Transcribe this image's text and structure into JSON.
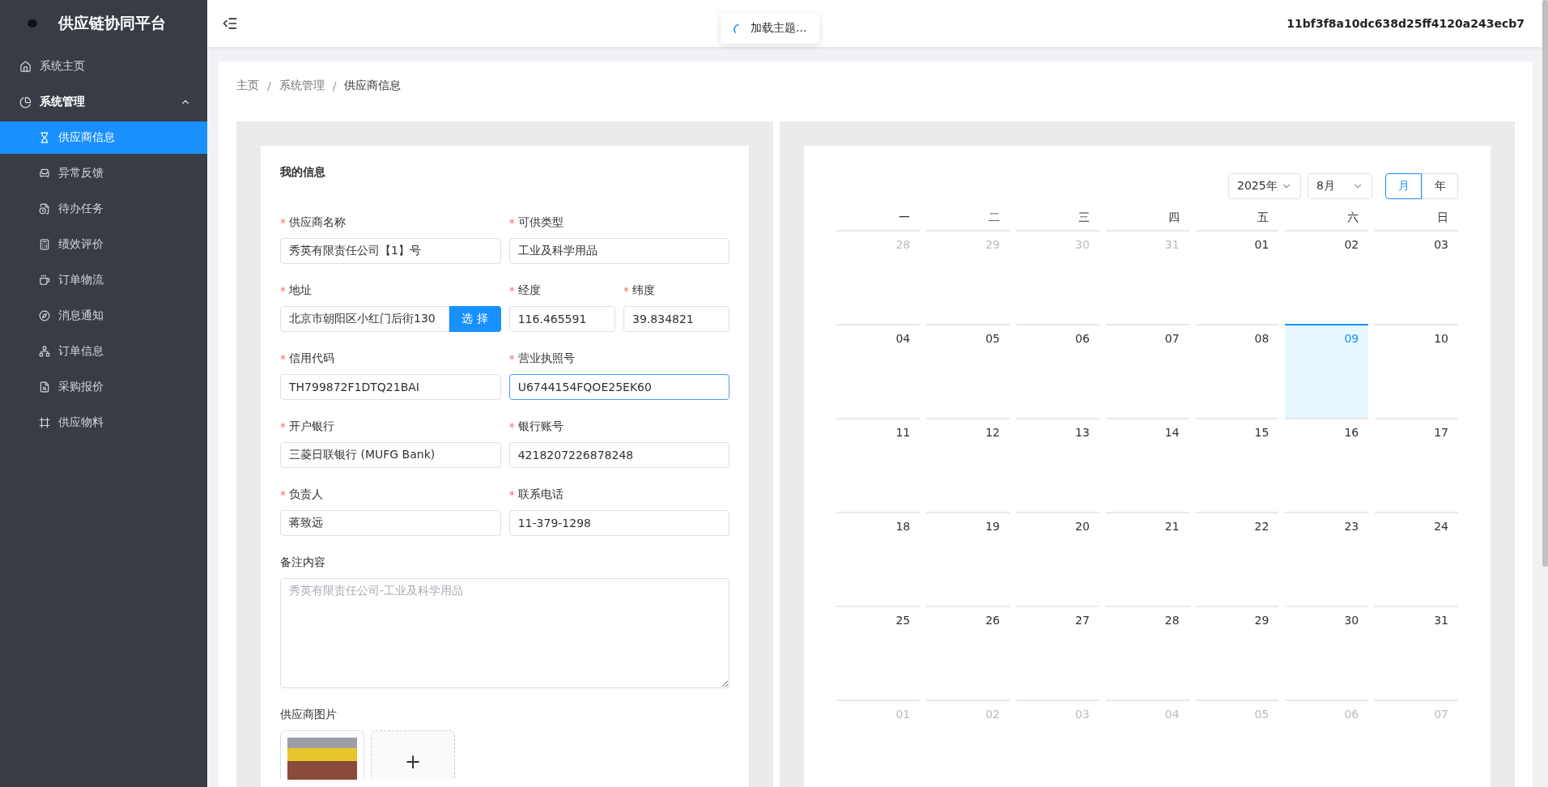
{
  "sidebar": {
    "title": "供应链协同平台",
    "items": [
      {
        "kind": "item",
        "label": "系统主页",
        "selected": false
      },
      {
        "kind": "group",
        "label": "系统管理",
        "expanded": true,
        "children": [
          {
            "label": "供应商信息",
            "selected": true
          },
          {
            "label": "异常反馈",
            "selected": false
          },
          {
            "label": "待办任务",
            "selected": false
          },
          {
            "label": "绩效评价",
            "selected": false
          },
          {
            "label": "订单物流",
            "selected": false
          },
          {
            "label": "消息通知",
            "selected": false
          },
          {
            "label": "订单信息",
            "selected": false
          },
          {
            "label": "采购报价",
            "selected": false
          },
          {
            "label": "供应物料",
            "selected": false
          }
        ]
      }
    ]
  },
  "header": {
    "user": "11bf3f8a10dc638d25ff4120a243ecb7"
  },
  "toast": {
    "text": "加载主题..."
  },
  "breadcrumb": {
    "separator": "/",
    "items": [
      "主页",
      "系统管理",
      "供应商信息"
    ]
  },
  "form": {
    "title": "我的信息",
    "required_mark": "*",
    "fields": [
      {
        "kind": "half",
        "label": "供应商名称",
        "required": true,
        "value": "秀英有限责任公司【1】号",
        "focused": false
      },
      {
        "kind": "half",
        "label": "可供类型",
        "required": true,
        "value": "工业及科学用品",
        "focused": false
      },
      {
        "kind": "address",
        "label": "地址",
        "required": true,
        "value": "北京市朝阳区小红门后街130",
        "button": "选 择",
        "focused": false
      },
      {
        "kind": "quarter",
        "label": "经度",
        "required": true,
        "value": "116.465591",
        "focused": false
      },
      {
        "kind": "quarter",
        "label": "纬度",
        "required": true,
        "value": "39.834821",
        "focused": false
      },
      {
        "kind": "half",
        "label": "信用代码",
        "required": true,
        "value": "TH799872F1DTQ21BAI",
        "focused": false
      },
      {
        "kind": "half",
        "label": "营业执照号",
        "required": true,
        "value": "U6744154FQOE25EK60",
        "focused": true
      },
      {
        "kind": "half",
        "label": "开户银行",
        "required": true,
        "value": "三菱日联银行 (MUFG Bank)",
        "focused": false
      },
      {
        "kind": "half",
        "label": "银行账号",
        "required": true,
        "value": "4218207226878248",
        "focused": false
      },
      {
        "kind": "half",
        "label": "负责人",
        "required": true,
        "value": "蒋致远",
        "focused": false
      },
      {
        "kind": "half",
        "label": "联系电话",
        "required": true,
        "value": "11-379-1298",
        "focused": false
      },
      {
        "kind": "textarea",
        "label": "备注内容",
        "required": false,
        "placeholder": "秀英有限责任公司-工业及科学用品"
      },
      {
        "kind": "upload",
        "label": "供应商图片",
        "required": false,
        "add": "+"
      }
    ]
  },
  "calendar": {
    "year": "2025年",
    "month": "8月",
    "modes": [
      {
        "label": "月",
        "selected": true
      },
      {
        "label": "年",
        "selected": false
      }
    ],
    "weekdays": [
      "一",
      "二",
      "三",
      "四",
      "五",
      "六",
      "日"
    ],
    "days": [
      {
        "label": "28",
        "in_month": false,
        "selected": false
      },
      {
        "label": "29",
        "in_month": false,
        "selected": false
      },
      {
        "label": "30",
        "in_month": false,
        "selected": false
      },
      {
        "label": "31",
        "in_month": false,
        "selected": false
      },
      {
        "label": "01",
        "in_month": true,
        "selected": false
      },
      {
        "label": "02",
        "in_month": true,
        "selected": false
      },
      {
        "label": "03",
        "in_month": true,
        "selected": false
      },
      {
        "label": "04",
        "in_month": true,
        "selected": false
      },
      {
        "label": "05",
        "in_month": true,
        "selected": false
      },
      {
        "label": "06",
        "in_month": true,
        "selected": false
      },
      {
        "label": "07",
        "in_month": true,
        "selected": false
      },
      {
        "label": "08",
        "in_month": true,
        "selected": false
      },
      {
        "label": "09",
        "in_month": true,
        "selected": true
      },
      {
        "label": "10",
        "in_month": true,
        "selected": false
      },
      {
        "label": "11",
        "in_month": true,
        "selected": false
      },
      {
        "label": "12",
        "in_month": true,
        "selected": false
      },
      {
        "label": "13",
        "in_month": true,
        "selected": false
      },
      {
        "label": "14",
        "in_month": true,
        "selected": false
      },
      {
        "label": "15",
        "in_month": true,
        "selected": false
      },
      {
        "label": "16",
        "in_month": true,
        "selected": false
      },
      {
        "label": "17",
        "in_month": true,
        "selected": false
      },
      {
        "label": "18",
        "in_month": true,
        "selected": false
      },
      {
        "label": "19",
        "in_month": true,
        "selected": false
      },
      {
        "label": "20",
        "in_month": true,
        "selected": false
      },
      {
        "label": "21",
        "in_month": true,
        "selected": false
      },
      {
        "label": "22",
        "in_month": true,
        "selected": false
      },
      {
        "label": "23",
        "in_month": true,
        "selected": false
      },
      {
        "label": "24",
        "in_month": true,
        "selected": false
      },
      {
        "label": "25",
        "in_month": true,
        "selected": false
      },
      {
        "label": "26",
        "in_month": true,
        "selected": false
      },
      {
        "label": "27",
        "in_month": true,
        "selected": false
      },
      {
        "label": "28",
        "in_month": true,
        "selected": false
      },
      {
        "label": "29",
        "in_month": true,
        "selected": false
      },
      {
        "label": "30",
        "in_month": true,
        "selected": false
      },
      {
        "label": "31",
        "in_month": true,
        "selected": false
      },
      {
        "label": "01",
        "in_month": false,
        "selected": false
      },
      {
        "label": "02",
        "in_month": false,
        "selected": false
      },
      {
        "label": "03",
        "in_month": false,
        "selected": false
      },
      {
        "label": "04",
        "in_month": false,
        "selected": false
      },
      {
        "label": "05",
        "in_month": false,
        "selected": false
      },
      {
        "label": "06",
        "in_month": false,
        "selected": false
      },
      {
        "label": "07",
        "in_month": false,
        "selected": false
      }
    ]
  }
}
